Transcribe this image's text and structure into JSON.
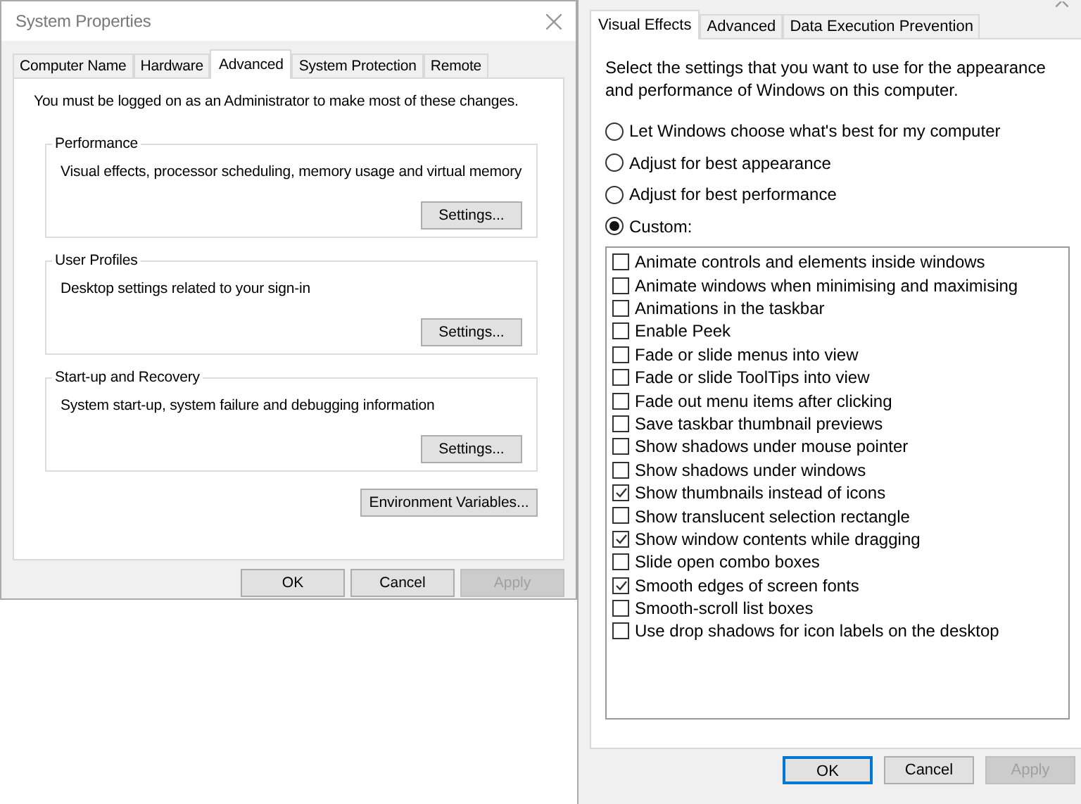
{
  "system_properties": {
    "title": "System Properties",
    "tabs": [
      {
        "label": "Computer Name",
        "selected": false
      },
      {
        "label": "Hardware",
        "selected": false
      },
      {
        "label": "Advanced",
        "selected": true
      },
      {
        "label": "System Protection",
        "selected": false
      },
      {
        "label": "Remote",
        "selected": false
      }
    ],
    "notice": "You must be logged on as an Administrator to make most of these changes.",
    "groups": [
      {
        "title": "Performance",
        "description": "Visual effects, processor scheduling, memory usage and virtual memory",
        "button": "Settings..."
      },
      {
        "title": "User Profiles",
        "description": "Desktop settings related to your sign-in",
        "button": "Settings..."
      },
      {
        "title": "Start-up and Recovery",
        "description": "System start-up, system failure and debugging information",
        "button": "Settings..."
      }
    ],
    "environment_button": "Environment Variables...",
    "buttons": [
      {
        "label": "OK",
        "disabled": false,
        "default": false
      },
      {
        "label": "Cancel",
        "disabled": false,
        "default": false
      },
      {
        "label": "Apply",
        "disabled": true,
        "default": false
      }
    ]
  },
  "performance_options": {
    "tabs": [
      {
        "label": "Visual Effects",
        "selected": true
      },
      {
        "label": "Advanced",
        "selected": false
      },
      {
        "label": "Data Execution Prevention",
        "selected": false
      }
    ],
    "description": "Select the settings that you want to use for the appearance and performance of Windows on this computer.",
    "options": [
      {
        "label": "Let Windows choose what's best for my computer",
        "selected": false
      },
      {
        "label": "Adjust for best appearance",
        "selected": false
      },
      {
        "label": "Adjust for best performance",
        "selected": false
      },
      {
        "label": "Custom:",
        "selected": true
      }
    ],
    "effects": [
      {
        "label": "Animate controls and elements inside windows",
        "checked": false
      },
      {
        "label": "Animate windows when minimising and maximising",
        "checked": false
      },
      {
        "label": "Animations in the taskbar",
        "checked": false
      },
      {
        "label": "Enable Peek",
        "checked": false
      },
      {
        "label": "Fade or slide menus into view",
        "checked": false
      },
      {
        "label": "Fade or slide ToolTips into view",
        "checked": false
      },
      {
        "label": "Fade out menu items after clicking",
        "checked": false
      },
      {
        "label": "Save taskbar thumbnail previews",
        "checked": false
      },
      {
        "label": "Show shadows under mouse pointer",
        "checked": false
      },
      {
        "label": "Show shadows under windows",
        "checked": false
      },
      {
        "label": "Show thumbnails instead of icons",
        "checked": true
      },
      {
        "label": "Show translucent selection rectangle",
        "checked": false
      },
      {
        "label": "Show window contents while dragging",
        "checked": true
      },
      {
        "label": "Slide open combo boxes",
        "checked": false
      },
      {
        "label": "Smooth edges of screen fonts",
        "checked": true
      },
      {
        "label": "Smooth-scroll list boxes",
        "checked": false
      },
      {
        "label": "Use drop shadows for icon labels on the desktop",
        "checked": false
      }
    ],
    "buttons": [
      {
        "label": "OK",
        "disabled": false,
        "default": true
      },
      {
        "label": "Cancel",
        "disabled": false,
        "default": false
      },
      {
        "label": "Apply",
        "disabled": true,
        "default": false
      }
    ]
  }
}
